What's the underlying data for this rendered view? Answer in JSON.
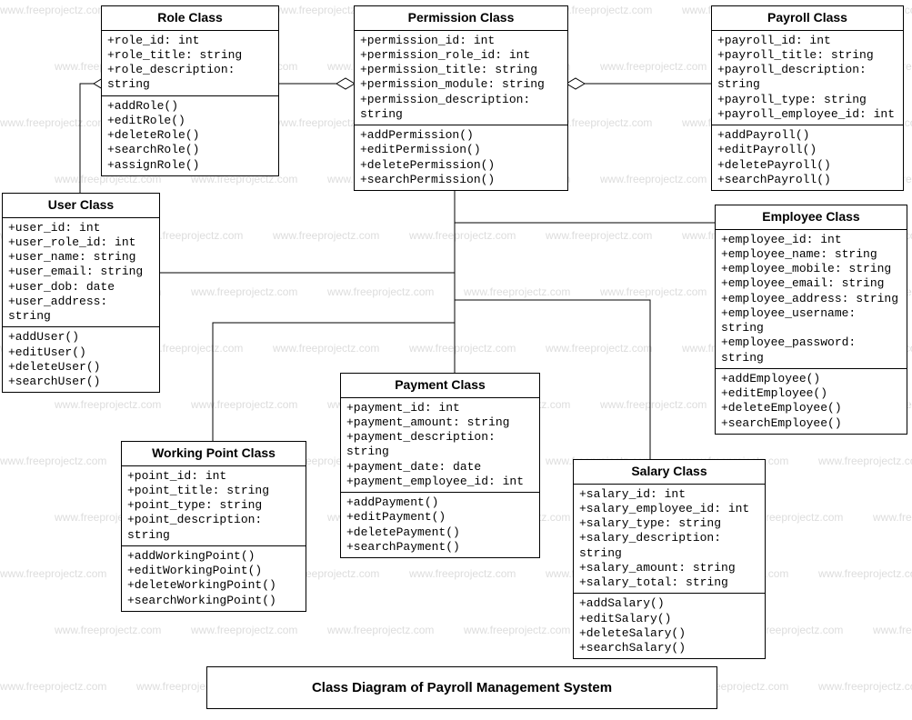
{
  "watermark": "www.freeprojectz.com",
  "title": "Class Diagram of Payroll Management System",
  "classes": {
    "role": {
      "name": "Role Class",
      "attrs": [
        "+role_id: int",
        "+role_title: string",
        "+role_description: string"
      ],
      "ops": [
        "+addRole()",
        "+editRole()",
        "+deleteRole()",
        "+searchRole()",
        "+assignRole()"
      ]
    },
    "permission": {
      "name": "Permission Class",
      "attrs": [
        "+permission_id: int",
        "+permission_role_id: int",
        "+permission_title: string",
        "+permission_module: string",
        "+permission_description: string"
      ],
      "ops": [
        "+addPermission()",
        "+editPermission()",
        "+deletePermission()",
        "+searchPermission()"
      ]
    },
    "payroll": {
      "name": "Payroll Class",
      "attrs": [
        "+payroll_id: int",
        "+payroll_title: string",
        "+payroll_description: string",
        "+payroll_type: string",
        "+payroll_employee_id: int"
      ],
      "ops": [
        "+addPayroll()",
        "+editPayroll()",
        "+deletePayroll()",
        "+searchPayroll()"
      ]
    },
    "user": {
      "name": "User Class",
      "attrs": [
        "+user_id: int",
        "+user_role_id: int",
        "+user_name: string",
        "+user_email: string",
        "+user_dob: date",
        "+user_address: string"
      ],
      "ops": [
        "+addUser()",
        "+editUser()",
        "+deleteUser()",
        "+searchUser()"
      ]
    },
    "employee": {
      "name": "Employee Class",
      "attrs": [
        "+employee_id: int",
        "+employee_name: string",
        "+employee_mobile: string",
        "+employee_email: string",
        "+employee_address: string",
        "+employee_username: string",
        "+employee_password: string"
      ],
      "ops": [
        "+addEmployee()",
        "+editEmployee()",
        "+deleteEmployee()",
        "+searchEmployee()"
      ]
    },
    "workingpoint": {
      "name": "Working Point Class",
      "attrs": [
        "+point_id: int",
        "+point_title: string",
        "+point_type: string",
        "+point_description: string"
      ],
      "ops": [
        "+addWorkingPoint()",
        "+editWorkingPoint()",
        "+deleteWorkingPoint()",
        "+searchWorkingPoint()"
      ]
    },
    "payment": {
      "name": "Payment Class",
      "attrs": [
        "+payment_id: int",
        "+payment_amount: string",
        "+payment_description: string",
        "+payment_date: date",
        "+payment_employee_id: int"
      ],
      "ops": [
        "+addPayment()",
        "+editPayment()",
        "+deletePayment()",
        "+searchPayment()"
      ]
    },
    "salary": {
      "name": "Salary Class",
      "attrs": [
        "+salary_id: int",
        "+salary_employee_id: int",
        "+salary_type: string",
        "+salary_description: string",
        "+salary_amount: string",
        "+salary_total: string"
      ],
      "ops": [
        "+addSalary()",
        "+editSalary()",
        "+deleteSalary()",
        "+searchSalary()"
      ]
    }
  }
}
